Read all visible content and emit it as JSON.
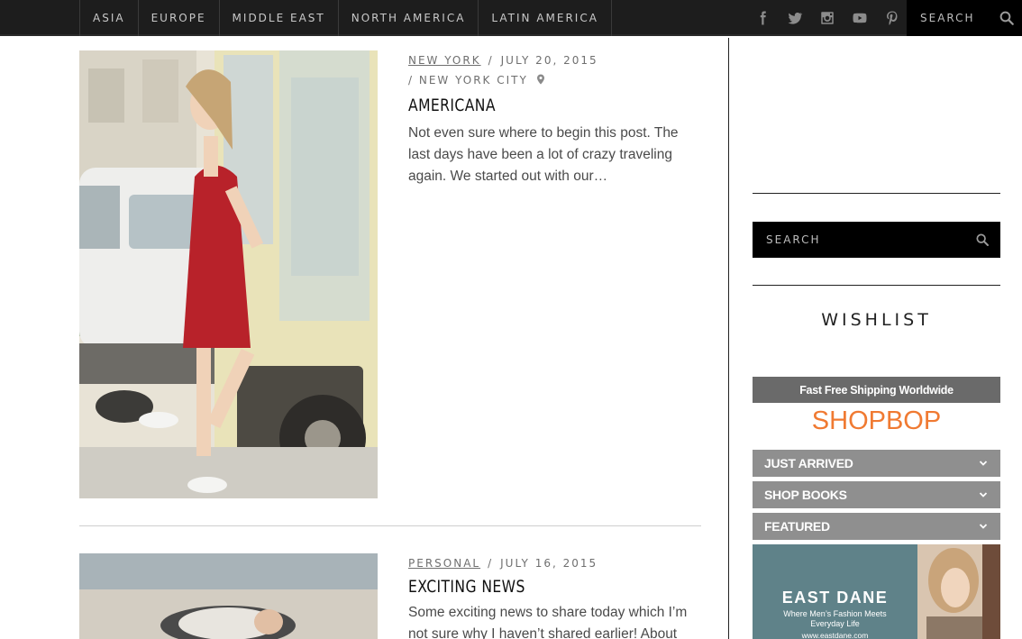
{
  "nav": {
    "items": [
      "ASIA",
      "EUROPE",
      "MIDDLE EAST",
      "NORTH AMERICA",
      "LATIN AMERICA"
    ],
    "socials": [
      "facebook-icon",
      "twitter-icon",
      "instagram-icon",
      "youtube-icon",
      "pinterest-icon"
    ],
    "search_placeholder": "SEARCH"
  },
  "posts": [
    {
      "category": "NEW YORK",
      "date": "JULY 20, 2015",
      "location": "NEW YORK CITY",
      "title": "AMERICANA",
      "excerpt": "Not even sure where to begin this post. The last days have been a lot of crazy traveling again. We started out with our…"
    },
    {
      "category": "PERSONAL",
      "date": "JULY 16, 2015",
      "title": "EXCITING NEWS",
      "excerpt": "Some exciting news to share today which I’m not sure why I haven’t shared earlier! About"
    }
  ],
  "sidebar": {
    "search_placeholder": "SEARCH",
    "wishlist_title": "WISHLIST",
    "shop_banner": "Fast Free Shipping Worldwide",
    "shop_logo": "SHOPBOP",
    "shop_rows": [
      "JUST ARRIVED",
      "SHOP BOOKS",
      "FEATURED"
    ],
    "ad": {
      "title": "EAST DANE",
      "subtitle_line1": "Where Men’s Fashion Meets",
      "subtitle_line2": "Everyday Life",
      "url": "www.eastdane.com"
    }
  },
  "colors": {
    "topbar": "#1d1d1d",
    "accent_shopbop": "#f07a32",
    "shop_row": "#8f8f8f",
    "eastdane": "#5f8289"
  }
}
